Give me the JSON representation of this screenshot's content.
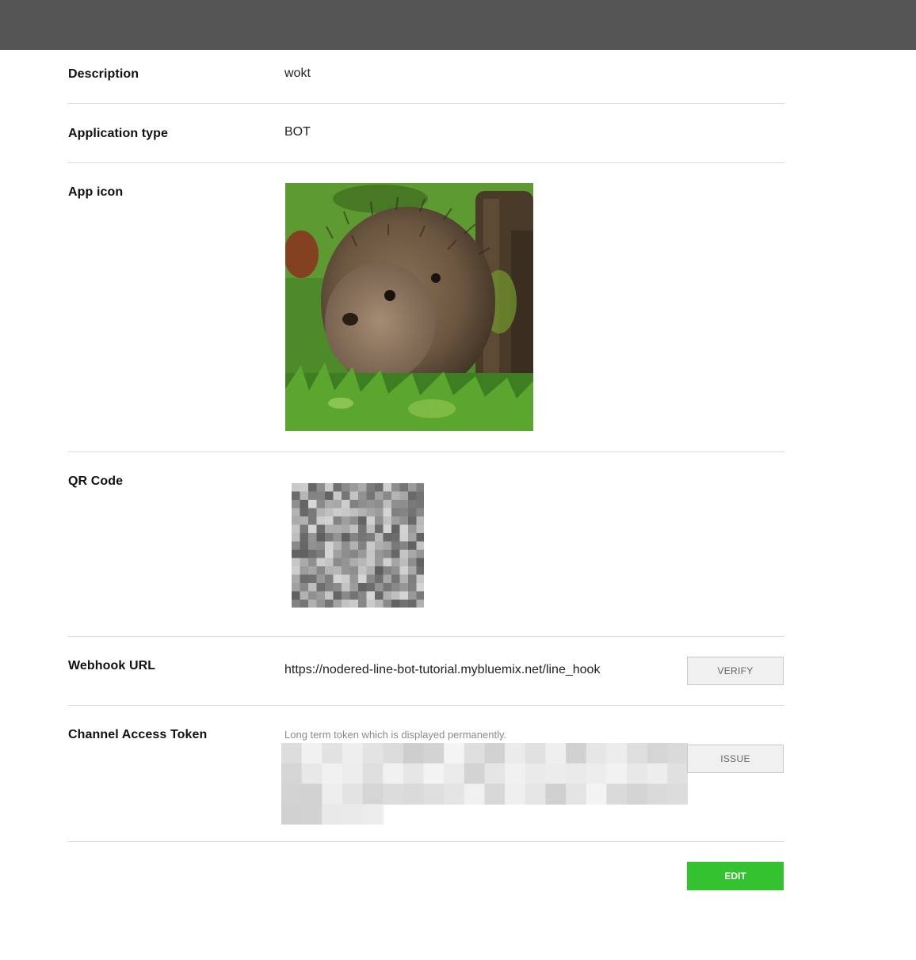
{
  "fields": {
    "description": {
      "label": "Description",
      "value": "wokt"
    },
    "application_type": {
      "label": "Application type",
      "value": "BOT"
    },
    "app_icon": {
      "label": "App icon"
    },
    "qr_code": {
      "label": "QR Code"
    },
    "webhook_url": {
      "label": "Webhook URL",
      "value": "https://nodered-line-bot-tutorial.mybluemix.net/line_hook",
      "button_label": "VERIFY"
    },
    "channel_access_token": {
      "label": "Channel Access Token",
      "hint": "Long term token which is displayed permanently.",
      "button_label": "ISSUE"
    }
  },
  "actions": {
    "edit_label": "EDIT"
  },
  "colors": {
    "top_bar": "#555555",
    "accent_green": "#34c230",
    "divider": "#dcdcdc"
  }
}
